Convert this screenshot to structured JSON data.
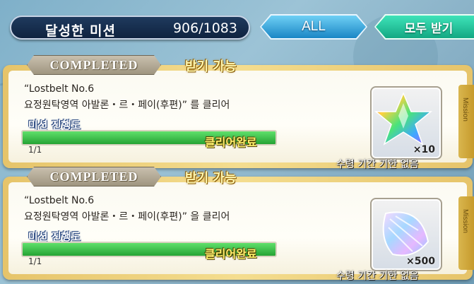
{
  "header": {
    "title": "달성한 미션",
    "count": "906/1083",
    "filter_label": "ALL",
    "claim_all_label": "모두 받기"
  },
  "missions": [
    {
      "status_badge": "COMPLETED",
      "claimable_label": "받기 가능",
      "line1": "“Lostbelt No.6",
      "line2": "요정원탁영역 아발론・르・페이(후편)” 를 클리어",
      "progress_label": "미션 진행도",
      "progress_count": "1/1",
      "progress_fraction": 1.0,
      "clear_label": "클리어완료",
      "reward_icon": "rainbow-star-quartz-icon",
      "reward_qty": "×10",
      "deadline_label": "수령 기간 기한 없음",
      "side_tab_label": "Mission"
    },
    {
      "status_badge": "COMPLETED",
      "claimable_label": "받기 가능",
      "line1": "“Lostbelt No.6",
      "line2": "요정원탁영역 아발론・르・페이(후편)” 을 클리어",
      "progress_label": "미션 진행도",
      "progress_count": "1/1",
      "progress_fraction": 1.0,
      "clear_label": "클리어완료",
      "reward_icon": "crystal-leaf-icon",
      "reward_qty": "×500",
      "deadline_label": "수령 기간 기한 없음",
      "side_tab_label": "Mission"
    }
  ],
  "colors": {
    "header_bg": "#0f2340",
    "all_button": "#1a86c5",
    "claim_all_button": "#13a883",
    "card_frame": "#e6c46a",
    "progress_fill": "#25a334"
  }
}
